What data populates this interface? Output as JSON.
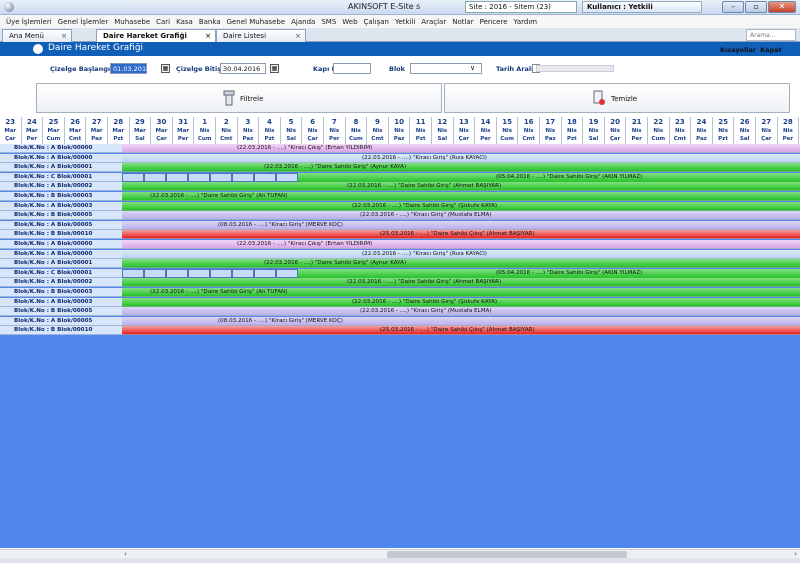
{
  "titlebar": {
    "title": "AKINSOFT E-Site s",
    "site": "Site : 2016 - Sitem (23)",
    "user": "Kullanıcı : Yetkili"
  },
  "menu": [
    "Üye İşlemleri",
    "Genel İşlemler",
    "Muhasebe",
    "Cari",
    "Kasa",
    "Banka",
    "Genel Muhasebe",
    "Ajanda",
    "SMS",
    "Web",
    "Çalışan",
    "Yetkili",
    "Araçlar",
    "Notlar",
    "Pencere",
    "Yardım"
  ],
  "tabs": [
    {
      "label": "Ana Menü"
    },
    {
      "label": "Daire Hareket Grafiği"
    },
    {
      "label": "Daire Listesi"
    }
  ],
  "search": {
    "placeholder": "Arama..."
  },
  "form": {
    "title": "Daire Hareket Grafiği",
    "links": [
      "Kısayollar",
      "Kapat"
    ]
  },
  "filters": {
    "start_label": "Çizelge Başlangıç",
    "start_value": "01.03.2016",
    "end_label": "Çizelge Bitişi",
    "end_value": "30.04.2016",
    "door_label": "Kapı No",
    "door_value": "",
    "block_label": "Blok",
    "block_value": "",
    "range_label": "Tarih Aralığı"
  },
  "actions": {
    "filter_label": "Filtrele",
    "clear_label": "Temizle"
  },
  "dates": [
    {
      "d": "23",
      "m": "Mar",
      "w": "Çar"
    },
    {
      "d": "24",
      "m": "Mar",
      "w": "Per"
    },
    {
      "d": "25",
      "m": "Mar",
      "w": "Cum"
    },
    {
      "d": "26",
      "m": "Mar",
      "w": "Cmt"
    },
    {
      "d": "27",
      "m": "Mar",
      "w": "Paz"
    },
    {
      "d": "28",
      "m": "Mar",
      "w": "Pzt"
    },
    {
      "d": "29",
      "m": "Mar",
      "w": "Sal"
    },
    {
      "d": "30",
      "m": "Mar",
      "w": "Çar"
    },
    {
      "d": "31",
      "m": "Mar",
      "w": "Per"
    },
    {
      "d": "1",
      "m": "Nis",
      "w": "Cum"
    },
    {
      "d": "2",
      "m": "Nis",
      "w": "Cmt"
    },
    {
      "d": "3",
      "m": "Nis",
      "w": "Paz"
    },
    {
      "d": "4",
      "m": "Nis",
      "w": "Pzt"
    },
    {
      "d": "5",
      "m": "Nis",
      "w": "Sal"
    },
    {
      "d": "6",
      "m": "Nis",
      "w": "Çar"
    },
    {
      "d": "7",
      "m": "Nis",
      "w": "Per"
    },
    {
      "d": "8",
      "m": "Nis",
      "w": "Cum"
    },
    {
      "d": "9",
      "m": "Nis",
      "w": "Cmt"
    },
    {
      "d": "10",
      "m": "Nis",
      "w": "Paz"
    },
    {
      "d": "11",
      "m": "Nis",
      "w": "Pzt"
    },
    {
      "d": "12",
      "m": "Nis",
      "w": "Sal"
    },
    {
      "d": "13",
      "m": "Nis",
      "w": "Çar"
    },
    {
      "d": "14",
      "m": "Nis",
      "w": "Per"
    },
    {
      "d": "15",
      "m": "Nis",
      "w": "Cum"
    },
    {
      "d": "16",
      "m": "Nis",
      "w": "Cmt"
    },
    {
      "d": "17",
      "m": "Nis",
      "w": "Paz"
    },
    {
      "d": "18",
      "m": "Nis",
      "w": "Pzt"
    },
    {
      "d": "19",
      "m": "Nis",
      "w": "Sal"
    },
    {
      "d": "20",
      "m": "Nis",
      "w": "Çar"
    },
    {
      "d": "21",
      "m": "Nis",
      "w": "Per"
    },
    {
      "d": "22",
      "m": "Nis",
      "w": "Cum"
    },
    {
      "d": "23",
      "m": "Nis",
      "w": "Cmt"
    },
    {
      "d": "24",
      "m": "Nis",
      "w": "Paz"
    },
    {
      "d": "25",
      "m": "Nis",
      "w": "Pzt"
    },
    {
      "d": "26",
      "m": "Nis",
      "w": "Sal"
    },
    {
      "d": "27",
      "m": "Nis",
      "w": "Çar"
    },
    {
      "d": "28",
      "m": "Nis",
      "w": "Per"
    }
  ],
  "rows": [
    {
      "label": "Blok/K.No : A Blok/00000",
      "style": "pink",
      "text": "(22.03.2016 - ....)   \"Kiracı Çıkış\"   (Erhan YILDIRIM)"
    },
    {
      "label": "Blok/K.No : A Blok/00000",
      "style": "lightblue",
      "text": "(22.03.2016 - ....)   \"Kiracı Giriş\"   (Rıza KAYACI)"
    },
    {
      "label": "Blok/K.No : A Blok/00001",
      "style": "green",
      "text": "(22.03.2016 - ....)   \"Daire Sahibi Giriş\"   (Aynur KAYA)"
    },
    {
      "label": "Blok/K.No : C Blok/00001",
      "style": "cells",
      "text": "(05.04.2016 - ....)   \"Daire Sahibi Giriş\"   (AKIN YILMAZ)"
    },
    {
      "label": "Blok/K.No : A Blok/00002",
      "style": "green",
      "text": "(22.03.2016 - ....)   \"Daire Sahibi Giriş\"   (Ahmet BAŞIYAR)"
    },
    {
      "label": "Blok/K.No : B Blok/00003",
      "style": "green",
      "text": "(22.03.2016 - ....)   \"Daire Sahibi Giriş\"   (Ali TUFAN)"
    },
    {
      "label": "Blok/K.No : A Blok/00003",
      "style": "green",
      "text": "(22.03.2016 - ....)   \"Daire Sahibi Giriş\"   (Şükufe KAYA)"
    },
    {
      "label": "Blok/K.No : B Blok/00005",
      "style": "lavender",
      "text": "(22.03.2016 - ....)   \"Kiracı Giriş\"   (Mustafa ELMA)"
    },
    {
      "label": "Blok/K.No : A Blok/00005",
      "style": "lavender",
      "text": "(08.03.2016 - ....)   \"Kiracı Giriş\"   (MERVE KOÇ)"
    },
    {
      "label": "Blok/K.No : B Blok/00010",
      "style": "red",
      "text": "(25.03.2016 - ....)   \"Daire Sahibi Çıkış\"   (Ahmet BAŞIYAR)"
    },
    {
      "label": "Blok/K.No : A Blok/00000",
      "style": "pink",
      "text": "(22.03.2016 - ....)   \"Kiracı Çıkış\"   (Erhan YILDIRIM)"
    },
    {
      "label": "Blok/K.No : A Blok/00000",
      "style": "lightblue",
      "text": "(22.03.2016 - ....)   \"Kiracı Giriş\"   (Rıza KAYACI)"
    },
    {
      "label": "Blok/K.No : A Blok/00001",
      "style": "green",
      "text": "(22.03.2016 - ....)   \"Daire Sahibi Giriş\"   (Aynur KAYA)"
    },
    {
      "label": "Blok/K.No : C Blok/00001",
      "style": "cells",
      "text": "(05.04.2016 - ....)   \"Daire Sahibi Giriş\"   (AKIN YILMAZ)"
    },
    {
      "label": "Blok/K.No : A Blok/00002",
      "style": "green",
      "text": "(22.03.2016 - ....)   \"Daire Sahibi Giriş\"   (Ahmet BAŞIYAR)"
    },
    {
      "label": "Blok/K.No : B Blok/00003",
      "style": "green",
      "text": "(22.03.2016 - ....)   \"Daire Sahibi Giriş\"   (Ali TUFAN)"
    },
    {
      "label": "Blok/K.No : A Blok/00003",
      "style": "green",
      "text": "(22.03.2016 - ....)   \"Daire Sahibi Giriş\"   (Şükufe KAYA)"
    },
    {
      "label": "Blok/K.No : B Blok/00005",
      "style": "lavender",
      "text": "(22.03.2016 - ....)   \"Kiracı Giriş\"   (Mustafa ELMA)"
    },
    {
      "label": "Blok/K.No : A Blok/00005",
      "style": "lavender",
      "text": "(08.03.2016 - ....)   \"Kiracı Giriş\"   (MERVE KOÇ)"
    },
    {
      "label": "Blok/K.No : B Blok/00010",
      "style": "red",
      "text": "(25.03.2016 - ....)   \"Daire Sahibi Çıkış\"   (Ahmet BAŞIYAR)"
    }
  ],
  "icons": {
    "filter": "funnel-icon",
    "clear": "eraser-icon",
    "calendar": "calendar-icon"
  }
}
